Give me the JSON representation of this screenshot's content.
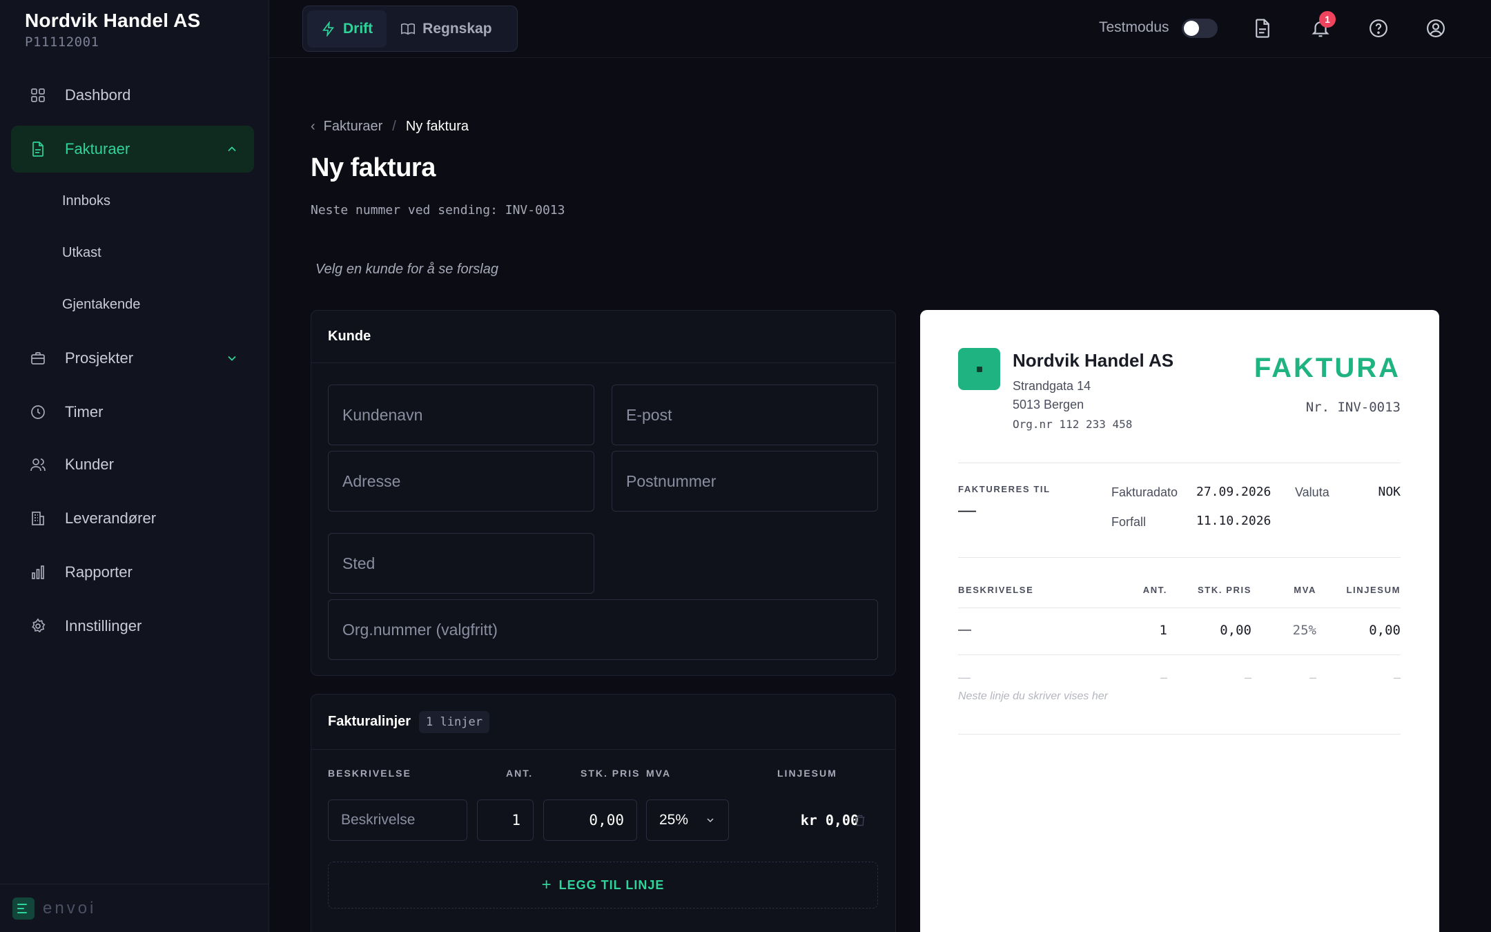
{
  "brand": {
    "name": "Nordvik Handel AS",
    "id": "P11112001",
    "footer_logo": "envoi"
  },
  "nav": {
    "dashboard": "Dashbord",
    "invoices": "Fakturaer",
    "invoices_sub": [
      "Innboks",
      "Utkast",
      "Gjentakende"
    ],
    "projects": "Prosjekter",
    "hours": "Timer",
    "customers": "Kunder",
    "suppliers": "Leverandører",
    "reports": "Rapporter",
    "settings": "Innstillinger"
  },
  "topbar": {
    "tab_ops": "Drift",
    "tab_accounting": "Regnskap",
    "test_mode_label": "Testmodus",
    "test_mode_on": false,
    "notification_count": "1"
  },
  "page": {
    "breadcrumb_parent": "Fakturaer",
    "breadcrumb_current": "Ny faktura",
    "title": "Ny faktura",
    "next_number": "Neste nummer ved sending: INV-0013",
    "hint": "Velg en kunde for å se forslag"
  },
  "customer_form": {
    "title": "Kunde",
    "name_placeholder": "Kundenavn",
    "email_placeholder": "E-post",
    "address_placeholder": "Adresse",
    "postal_placeholder": "Postnummer",
    "city_placeholder": "Sted",
    "orgnr_placeholder": "Org.nummer (valgfritt)"
  },
  "lines": {
    "title": "Fakturalinjer",
    "count": "1 linjer",
    "columns": {
      "desc": "BESKRIVELSE",
      "qty": "ANT.",
      "unit_price": "STK. PRIS",
      "vat": "MVA",
      "line_sum": "LINJESUM"
    },
    "rows": [
      {
        "desc_placeholder": "Beskrivelse",
        "qty": "1",
        "unit_price": "0,00",
        "vat": "25%",
        "line_sum": "kr 0,00"
      }
    ],
    "add_line": "LEGG TIL LINJE"
  },
  "preview": {
    "company": "Nordvik Handel AS",
    "street": "Strandgata 14",
    "city": "5013 Bergen",
    "orgnr": "Org.nr 112 233 458",
    "doc_title": "FAKTURA",
    "number": "Nr. INV-0013",
    "bill_to_label": "FAKTURERES TIL",
    "bill_to_value": "—",
    "invoice_date_label": "Fakturadato",
    "invoice_date": "27.09.2026",
    "due_label": "Forfall",
    "due_date": "11.10.2026",
    "currency_label": "Valuta",
    "currency": "NOK",
    "columns": {
      "desc": "BESKRIVELSE",
      "qty": "ANT.",
      "unit_price": "STK. PRIS",
      "vat": "MVA",
      "line_sum": "LINJESUM"
    },
    "row": {
      "desc": "—",
      "qty": "1",
      "unit_price": "0,00",
      "vat": "25%",
      "line_sum": "0,00"
    },
    "ghost": {
      "desc": "—",
      "qty": "–",
      "unit_price": "–",
      "vat": "–",
      "line_sum": "–"
    },
    "ghost_note": "Neste linje du skriver vises her"
  },
  "colors": {
    "accent": "#2ed49a",
    "preview_accent": "#1fb382",
    "badge": "#f0445e"
  }
}
